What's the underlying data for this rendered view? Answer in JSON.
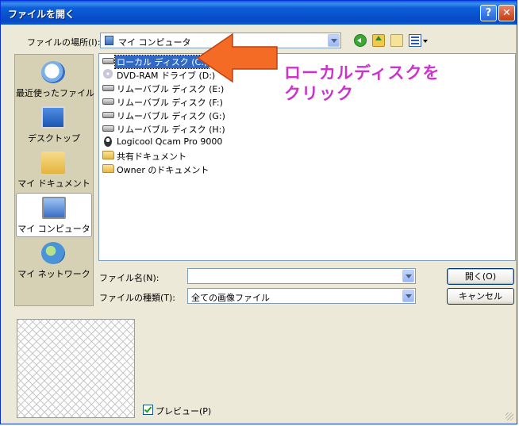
{
  "window": {
    "title": "ファイルを開く"
  },
  "titlebar": {
    "help_label": "?",
    "close_label": "✕"
  },
  "lookin": {
    "label": "ファイルの場所(I):",
    "value": "マイ コンピュータ"
  },
  "toolbar": {
    "icons": [
      "back-icon",
      "up-folder-icon",
      "new-folder-icon",
      "view-menu-icon"
    ]
  },
  "places": [
    {
      "label": "最近使ったファイル",
      "icon": "recent-clock-icon"
    },
    {
      "label": "デスクトップ",
      "icon": "desktop-icon"
    },
    {
      "label": "マイ ドキュメント",
      "icon": "my-documents-icon"
    },
    {
      "label": "マイ コンピュータ",
      "icon": "my-computer-icon",
      "selected": true
    },
    {
      "label": "マイ ネットワーク",
      "icon": "my-network-icon"
    }
  ],
  "files": [
    {
      "name": "ローカル ディスク (C:)",
      "icon": "hard-drive-icon",
      "selected": true
    },
    {
      "name": "DVD-RAM ドライブ (D:)",
      "icon": "dvd-drive-icon"
    },
    {
      "name": "リムーバブル ディスク (E:)",
      "icon": "removable-disk-icon"
    },
    {
      "name": "リムーバブル ディスク (F:)",
      "icon": "removable-disk-icon"
    },
    {
      "name": "リムーバブル ディスク (G:)",
      "icon": "removable-disk-icon"
    },
    {
      "name": "リムーバブル ディスク (H:)",
      "icon": "removable-disk-icon"
    },
    {
      "name": "Logicool Qcam Pro 9000",
      "icon": "webcam-icon"
    },
    {
      "name": "共有ドキュメント",
      "icon": "folder-icon"
    },
    {
      "name": "Owner のドキュメント",
      "icon": "folder-icon"
    }
  ],
  "callout": {
    "line1": "ローカルディスクを",
    "line2": "クリック",
    "color": "#cc33cc",
    "arrow_color": "#f36b24"
  },
  "filename": {
    "label": "ファイル名(N):",
    "value": ""
  },
  "filetype": {
    "label": "ファイルの種類(T):",
    "value": "全ての画像ファイル"
  },
  "buttons": {
    "open": "開く(O)",
    "cancel": "キャンセル"
  },
  "preview": {
    "label": "プレビュー(P)",
    "checked": true
  }
}
